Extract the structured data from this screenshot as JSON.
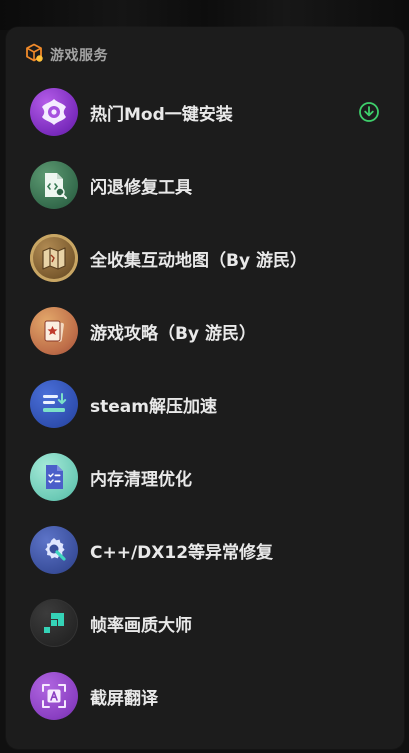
{
  "section": {
    "title": "游戏服务",
    "icon": "game-box-icon"
  },
  "items": [
    {
      "label": "热门Mod一键安装",
      "icon": "mod-install-icon",
      "action_icon": "download-circle-icon",
      "action_color": "#3ecf6b"
    },
    {
      "label": "闪退修复工具",
      "icon": "crash-fix-icon"
    },
    {
      "label": "全收集互动地图（By 游民）",
      "icon": "map-icon"
    },
    {
      "label": "游戏攻略（By 游民）",
      "icon": "guide-book-icon"
    },
    {
      "label": "steam解压加速",
      "icon": "steam-accelerate-icon"
    },
    {
      "label": "内存清理优化",
      "icon": "memory-clean-icon"
    },
    {
      "label": "C++/DX12等异常修复",
      "icon": "runtime-repair-icon"
    },
    {
      "label": "帧率画质大师",
      "icon": "frame-rate-icon"
    },
    {
      "label": "截屏翻译",
      "icon": "screenshot-translate-icon"
    }
  ],
  "colors": {
    "panel_bg": "#1c1c1c",
    "text_primary": "#e9e9e9",
    "text_secondary": "#a3a3a3",
    "accent_green": "#3ecf6b",
    "accent_orange": "#f08a2a"
  }
}
